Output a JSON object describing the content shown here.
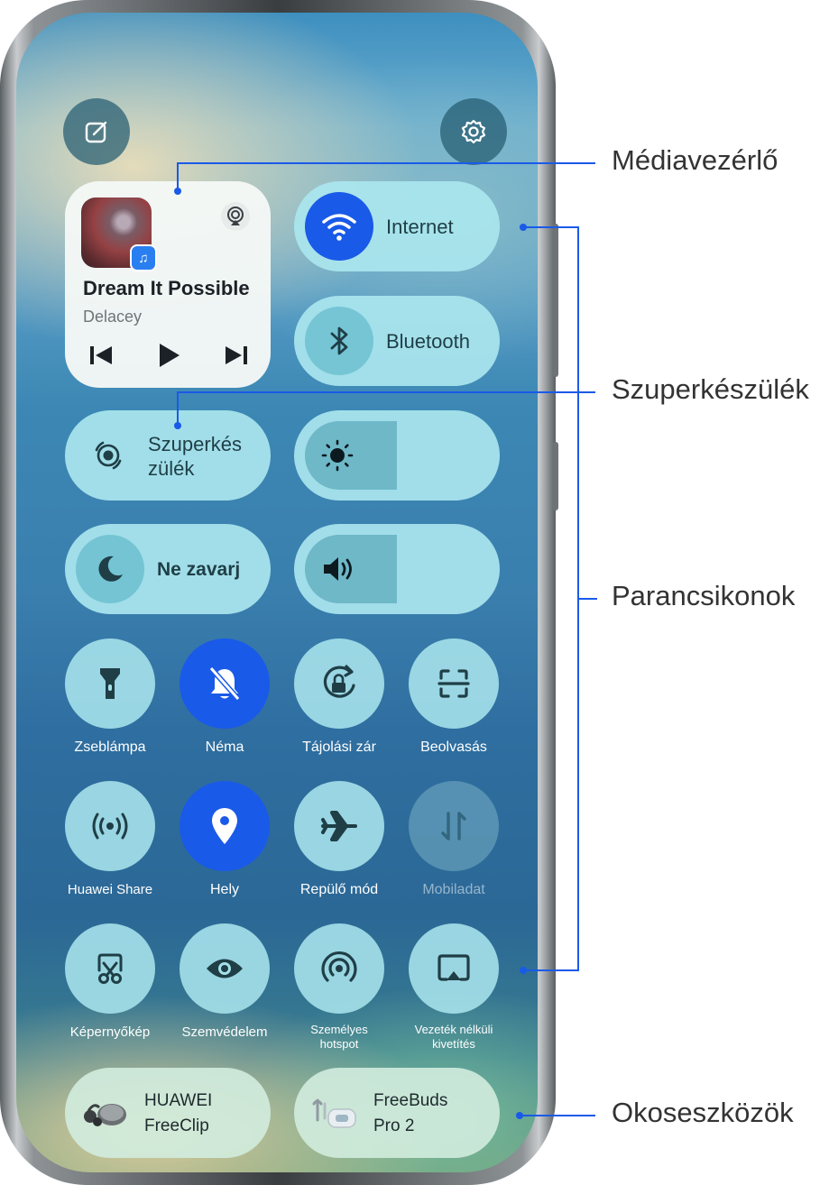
{
  "media": {
    "title": "Dream It Possible",
    "artist": "Delacey",
    "app_badge_icon": "music-note-icon"
  },
  "toggles": {
    "internet": "Internet",
    "bluetooth": "Bluetooth",
    "superdevice": "Szuperkés\nzülék",
    "dnd": "Ne zavarj"
  },
  "tiles": [
    {
      "label": "Zseblámpa",
      "icon": "flashlight-icon",
      "active": false
    },
    {
      "label": "Néma",
      "icon": "bell-off-icon",
      "active": true
    },
    {
      "label": "Tájolási zár",
      "icon": "rotation-lock-icon",
      "active": false
    },
    {
      "label": "Beolvasás",
      "icon": "scan-icon",
      "active": false
    },
    {
      "label": "Huawei Share",
      "icon": "huawei-share-icon",
      "active": false
    },
    {
      "label": "Hely",
      "icon": "location-icon",
      "active": true
    },
    {
      "label": "Repülő mód",
      "icon": "airplane-icon",
      "active": false
    },
    {
      "label": "Mobiladat",
      "icon": "mobile-data-icon",
      "active": false,
      "disabled": true
    },
    {
      "label": "Képernyőkép",
      "icon": "screenshot-icon",
      "active": false
    },
    {
      "label": "Szemvédelem",
      "icon": "eye-icon",
      "active": false
    },
    {
      "label": "Személyes\nhotspot",
      "icon": "hotspot-icon",
      "active": false
    },
    {
      "label": "Vezeték nélküli\nkivetítés",
      "icon": "wireless-projection-icon",
      "active": false
    }
  ],
  "devices": [
    {
      "line1": "HUAWEI",
      "line2": "FreeClip"
    },
    {
      "line1": "FreeBuds",
      "line2": "Pro 2"
    }
  ],
  "callouts": {
    "media": "Médiavezérlő",
    "superdevice": "Szuperkészülék",
    "shortcuts": "Parancsikonok",
    "smart_devices": "Okoseszközök"
  },
  "sliders": {
    "brightness_level": 0.5,
    "volume_level": 0.5
  },
  "colors": {
    "accent": "#1a5ae8",
    "tile_bg": "#a5e1ea",
    "text_dark": "#1f3e46"
  }
}
